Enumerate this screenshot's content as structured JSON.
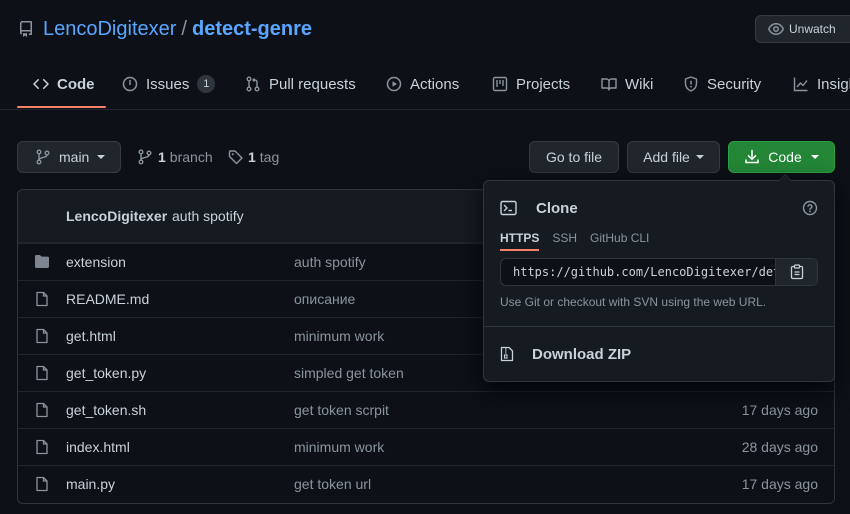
{
  "repo": {
    "owner": "LencoDigitexer",
    "separator": "/",
    "name": "detect-genre"
  },
  "watch": {
    "label": "Unwatch"
  },
  "tabs": [
    {
      "label": "Code",
      "icon": "code-icon"
    },
    {
      "label": "Issues",
      "icon": "issue-icon",
      "count": "1"
    },
    {
      "label": "Pull requests",
      "icon": "pull-request-icon"
    },
    {
      "label": "Actions",
      "icon": "play-icon"
    },
    {
      "label": "Projects",
      "icon": "project-icon"
    },
    {
      "label": "Wiki",
      "icon": "book-icon"
    },
    {
      "label": "Security",
      "icon": "shield-icon"
    },
    {
      "label": "Insights",
      "icon": "graph-icon"
    }
  ],
  "toolbar": {
    "branch": "main",
    "branch_count": "1",
    "branch_label": "branch",
    "tag_count": "1",
    "tag_label": "tag",
    "go_to_file": "Go to file",
    "add_file": "Add file",
    "code": "Code"
  },
  "latest_commit": {
    "author": "LencoDigitexer",
    "message": "auth spotify"
  },
  "files": [
    {
      "name": "extension",
      "type": "dir",
      "message": "auth spotify",
      "age": ""
    },
    {
      "name": "README.md",
      "type": "file",
      "message": "описание",
      "age": ""
    },
    {
      "name": "get.html",
      "type": "file",
      "message": "minimum work",
      "age": ""
    },
    {
      "name": "get_token.py",
      "type": "file",
      "message": "simpled get token",
      "age": ""
    },
    {
      "name": "get_token.sh",
      "type": "file",
      "message": "get token scrpit",
      "age": "17 days ago"
    },
    {
      "name": "index.html",
      "type": "file",
      "message": "minimum work",
      "age": "28 days ago"
    },
    {
      "name": "main.py",
      "type": "file",
      "message": "get token url",
      "age": "17 days ago"
    }
  ],
  "clone": {
    "title": "Clone",
    "tabs": [
      "HTTPS",
      "SSH",
      "GitHub CLI"
    ],
    "url": "https://github.com/LencoDigitexer/detect-genre.git",
    "hint": "Use Git or checkout with SVN using the web URL.",
    "download_zip": "Download ZIP"
  },
  "colors": {
    "accent_link": "#58a6ff",
    "tab_underline": "#f78166",
    "primary_button": "#238636",
    "background": "#0d1117"
  }
}
